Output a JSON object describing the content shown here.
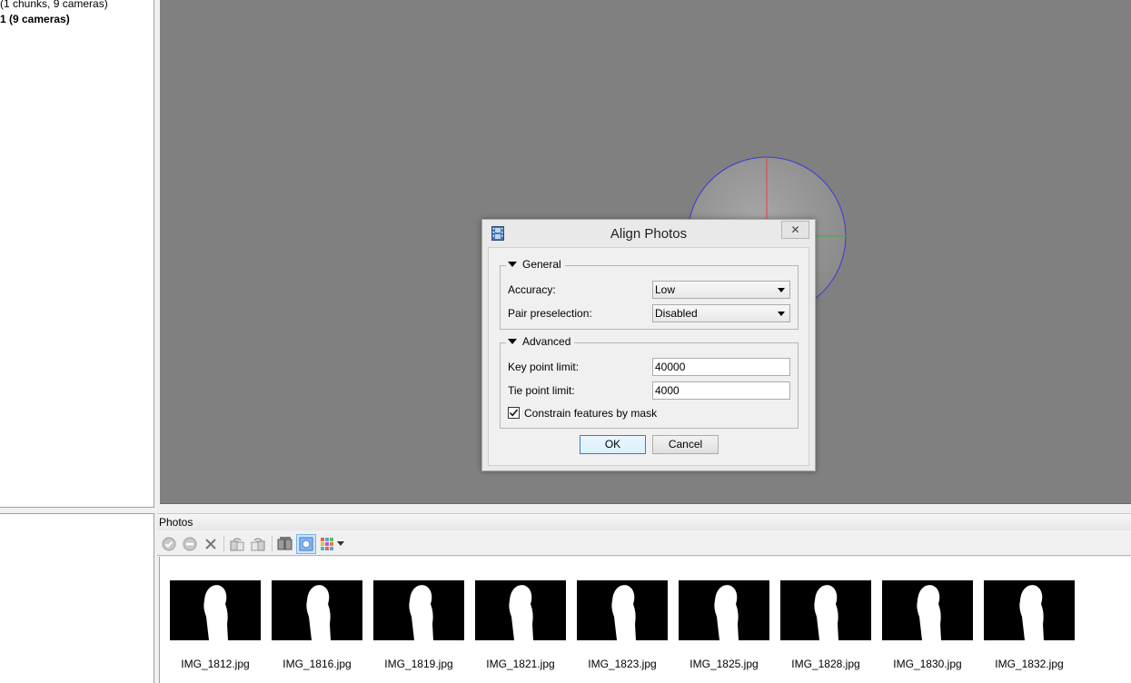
{
  "workspace": {
    "summary": "(1 chunks, 9 cameras)",
    "chunk": "1 (9 cameras)"
  },
  "photos_pane": {
    "title": "Photos",
    "toolbar_icons": [
      "enable-camera-icon",
      "disable-camera-icon",
      "remove-icon",
      "rotate-right-icon",
      "rotate-left-icon",
      "view-details-icon",
      "show-masks-icon",
      "thumbnail-grid-icon",
      "dropdown-arrow-icon"
    ],
    "photos": [
      {
        "filename": "IMG_1812.jpg"
      },
      {
        "filename": "IMG_1816.jpg"
      },
      {
        "filename": "IMG_1819.jpg"
      },
      {
        "filename": "IMG_1821.jpg"
      },
      {
        "filename": "IMG_1823.jpg"
      },
      {
        "filename": "IMG_1825.jpg"
      },
      {
        "filename": "IMG_1828.jpg"
      },
      {
        "filename": "IMG_1830.jpg"
      },
      {
        "filename": "IMG_1832.jpg"
      }
    ]
  },
  "dialog": {
    "title": "Align Photos",
    "close_glyph": "✕",
    "general": {
      "title": "General",
      "accuracy_label": "Accuracy:",
      "accuracy_value": "Low",
      "pair_label": "Pair preselection:",
      "pair_value": "Disabled"
    },
    "advanced": {
      "title": "Advanced",
      "key_label": "Key point limit:",
      "key_value": "40000",
      "tie_label": "Tie point limit:",
      "tie_value": "4000",
      "mask_label": "Constrain features by mask",
      "mask_checked": true
    },
    "ok_label": "OK",
    "cancel_label": "Cancel"
  },
  "colors": {
    "viewport_bg": "#808080",
    "dialog_bg": "#f0f0f0",
    "default_button_border": "#3c7fb1",
    "thumbnail_bg": "#000000",
    "silhouette": "#ffffff"
  }
}
